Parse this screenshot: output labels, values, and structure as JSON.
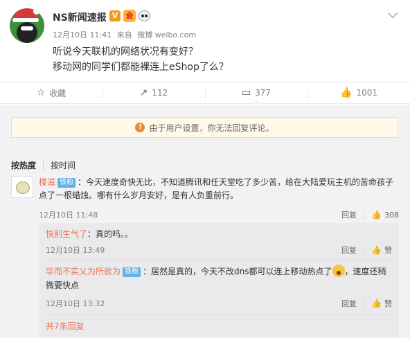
{
  "post": {
    "author": "NS新闻速报",
    "v_badge": "V",
    "vip_badge": "会",
    "date": "12月10日 11:41",
    "source_prefix": "来自",
    "source": "微博 weibo.com",
    "line1": "听说今天联机的网络状况有变好？",
    "line2": "移动网的同学们都能裸连上eShop了么？",
    "icons": [
      "avatar-christmas-penguin",
      "verified-v-icon",
      "vip-icon",
      "panda-icon",
      "chevron-down-icon"
    ]
  },
  "actions": [
    {
      "icon": "☆",
      "label": "收藏",
      "name": "favorite"
    },
    {
      "icon": "↗",
      "label": "112",
      "name": "repost"
    },
    {
      "icon": "▭",
      "label": "377",
      "name": "comment"
    },
    {
      "icon": "👍",
      "label": "1001",
      "name": "like"
    }
  ],
  "notice": {
    "icon": "!",
    "text": "由于用户设置，你无法回复评论。"
  },
  "sort": {
    "hot": "按热度",
    "time": "按时间"
  },
  "comment": {
    "user": "楼滋",
    "fan_badge": "铁粉",
    "text": "：今天速度奇快无比，不知道腾讯和任天堂吃了多少苦，给在大陆爱玩主机的苦命孩子点了一根蜡烛。哪有什么岁月安好，是有人负重前行。",
    "time": "12月10日 11:48",
    "reply": "回复",
    "likes": "308"
  },
  "replies": [
    {
      "user": "快别生气了",
      "text": "：真的吗。。",
      "time": "12月10日 13:49",
      "reply": "回复",
      "like": "赞"
    },
    {
      "user": "华而不实乂为所欲为",
      "fan_badge": "铁粉",
      "text_before": "：居然是真的，今天不改dns都可以连上移动热点了",
      "text_after": "，速度还稍微要快点",
      "time": "12月10日 13:32",
      "reply": "回复",
      "like": "赞"
    }
  ],
  "more_replies": "共7条回复",
  "colors": {
    "username": "#eb7350",
    "fan_badge": "#62b2e6",
    "comments_bg": "#f2f2f5",
    "notice_bg": "#fef9e9"
  }
}
